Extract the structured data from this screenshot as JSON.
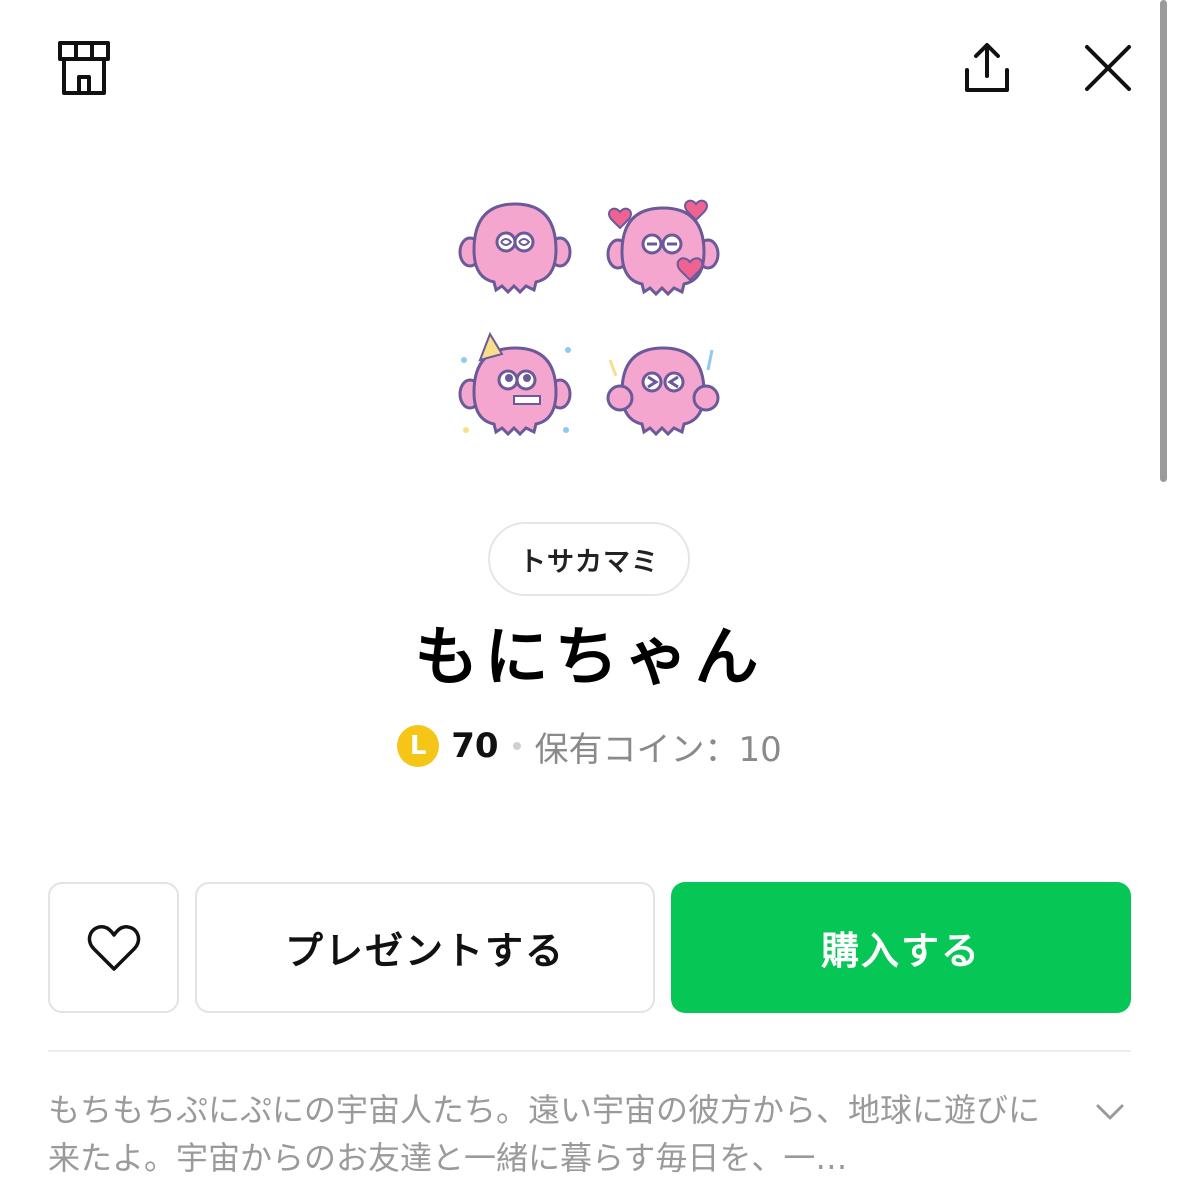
{
  "header": {
    "store_icon": "store-icon",
    "share_icon": "share-icon",
    "close_icon": "close-icon"
  },
  "sticker_preview": {
    "items": [
      "sticker-confused",
      "sticker-hearts",
      "sticker-party",
      "sticker-excited"
    ]
  },
  "product": {
    "author": "トサカマミ",
    "title": "もにちゃん",
    "coin_symbol": "L",
    "price": "70",
    "owned_coins": "保有コイン：10"
  },
  "actions": {
    "favorite_icon": "heart-icon",
    "gift_label": "プレゼントする",
    "buy_label": "購入する"
  },
  "description": {
    "text": "もちもちぷにぷにの宇宙人たち。遠い宇宙の彼方から、地球に遊びに来たよ。宇宙からのお友達と一緒に暮らす毎日を、一…",
    "expand_icon": "chevron-down-icon"
  },
  "colors": {
    "accent": "#06c755",
    "coin": "#f5c518",
    "sticker_pink": "#f5a6cf"
  }
}
